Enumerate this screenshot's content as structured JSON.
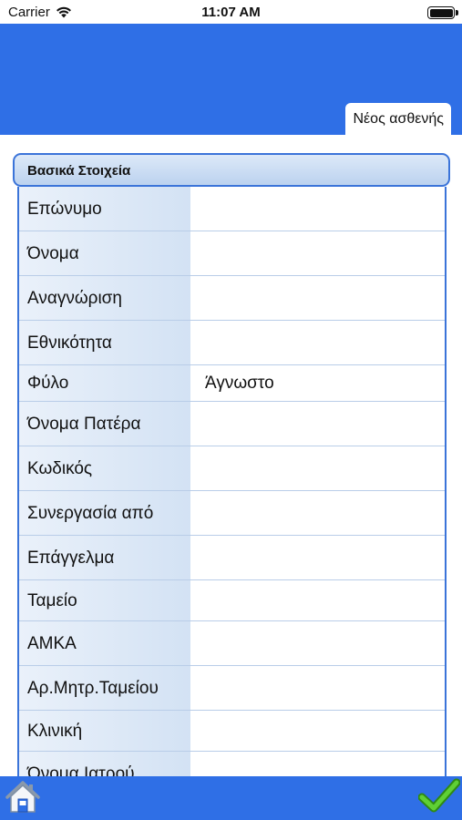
{
  "status_bar": {
    "carrier": "Carrier",
    "time": "11:07 AM"
  },
  "header": {
    "tab_label": "Νέος ασθενής"
  },
  "section": {
    "title": "Βασικά Στοιχεία"
  },
  "form": {
    "rows": [
      {
        "label": "Επώνυμο",
        "value": ""
      },
      {
        "label": "Όνομα",
        "value": ""
      },
      {
        "label": "Αναγνώριση",
        "value": ""
      },
      {
        "label": "Εθνικότητα",
        "value": ""
      },
      {
        "label": "Φύλο",
        "value": "Άγνωστο"
      },
      {
        "label": "Όνομα Πατέρα",
        "value": ""
      },
      {
        "label": "Κωδικός",
        "value": ""
      },
      {
        "label": "Συνεργασία από",
        "value": ""
      },
      {
        "label": "Επάγγελμα",
        "value": ""
      },
      {
        "label": "Ταμείο",
        "value": ""
      },
      {
        "label": "ΑΜΚΑ",
        "value": ""
      },
      {
        "label": "Αρ.Μητρ.Ταμείου",
        "value": ""
      },
      {
        "label": "Κλινική",
        "value": ""
      },
      {
        "label": "Όνομα Ιατρού",
        "value": ""
      }
    ]
  },
  "colors": {
    "header_blue": "#2f6fe6",
    "border_blue": "#3b74d9",
    "check_green": "#3fae1f"
  },
  "footer": {
    "home_icon": "home-icon",
    "confirm_icon": "checkmark-icon"
  }
}
